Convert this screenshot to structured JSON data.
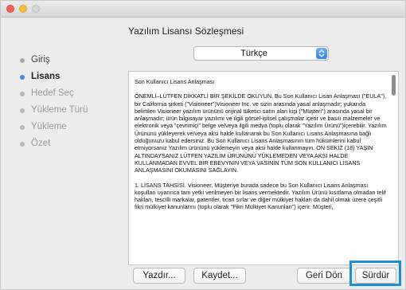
{
  "window": {
    "heading": "Yazılım Lisansı Sözleşmesi"
  },
  "sidebar": {
    "steps": [
      {
        "label": "Giriş"
      },
      {
        "label": "Lisans"
      },
      {
        "label": "Hedef Seç"
      },
      {
        "label": "Yükleme Türü"
      },
      {
        "label": "Yükleme"
      },
      {
        "label": "Özet"
      }
    ]
  },
  "language_select": {
    "value": "Türkçe"
  },
  "license": {
    "title": "Son Kullanıcı Lisans Anlaşması",
    "paragraph1": "ÖNEMLİ–LÜTFEN DİKKATLİ BİR ŞEKİLDE OKUYUN.  Bu Son Kullanıcı Lisan Anlaşması (\"EULA\"), bir California şirketi (\"Visioneer\")Visioneer Inc. ve sizin arasında yasal anlaşmadır; yukarıda belirtilen Visioneer yazılım ürününü orijinal tüketici satın alan kişi (\"Müşteri\") arasında yasal bir anlaşmadır; ürün bilgisayar yazılımı ve ilgili görsel-işitsel çalışmalar içerir ve basılı malzemeler ve elektronik veya \"çevrimiçi\" belge ve/veya ilgili medya (toplu olarak \"Yazılım Ürünü\")içerebilir.  Yazılım Ürününü yükleyerek ve/veya aksi halde kullanarak bu Son Kullanıcı Lisans Anlaşmasına bağlı olduğunuzu kabul edersiniz.  Bu Son Kullanıcı Lisans Anlaşmasının tüm hükümlerini kabul etmiyorsanız Yazılım ürününü yüklemeyin veya aksi halde kullanmayın.  ON SEKİZ (18) YAŞIN ALTINDAYSANIZ LÜTFEN YAZILIM ÜRÜNÜNÜ YÜKLEMEDEN VEYA AKSİ HALDE KULLANMADAN EVVEL BİR EBEVYNİN VEYA VASİNİN TÜM SON KULLANICI LİSANS ANLAŞMASINI OKUMASINI SAĞLAYIN.",
    "section1_title": "1.        LİSANS TAHSİSİ.  Visioneer, Müşteriye burada sadece bu Son Kullanıcı Lisans Anlaşması koşulları uyarınca tam yetki verilmeyen bir lisans vermektedir.  Yazılım Ürünü kısıtlama olmadan telif hakları, tescilli markalar, patentler, ticari sırlar ve diğer mülkiyet hakları da dahil olmak üzere çeşitli fikri mülkiyet kanunlarını (toplu olarak \"Fikri Mülkiyet Kanunları\") içerir.  Müşteri,"
  },
  "buttons": {
    "print": "Yazdır...",
    "save": "Kaydet...",
    "back": "Geri Dön",
    "continue": "Sürdür"
  }
}
